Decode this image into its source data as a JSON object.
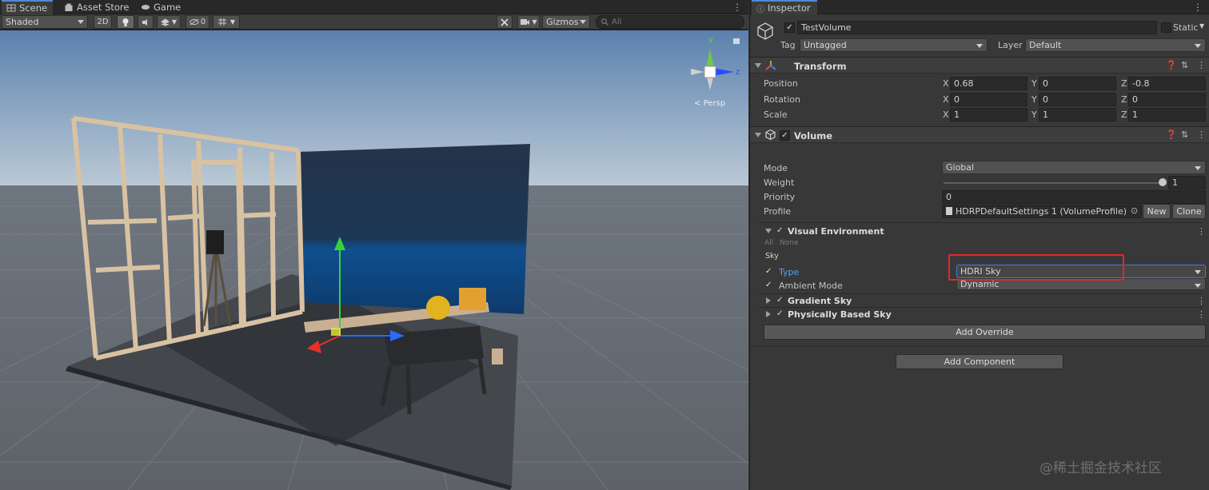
{
  "scene_tabs": [
    {
      "label": "Scene",
      "icon": "scene-grid-icon"
    },
    {
      "label": "Asset Store",
      "icon": "store-bag-icon"
    },
    {
      "label": "Game",
      "icon": "gamepad-icon"
    }
  ],
  "scene_toolbar": {
    "shading_mode": "Shaded",
    "mode_2d": "2D",
    "hidden_count": "0",
    "gizmos": "Gizmos",
    "search_placeholder": "All"
  },
  "viewport": {
    "orientation_axes": {
      "y": "y",
      "z": "z"
    },
    "projection": "Persp"
  },
  "inspector": {
    "tab": "Inspector",
    "object": {
      "name": "TestVolume",
      "static_label": "Static",
      "tag_label": "Tag",
      "tag": "Untagged",
      "layer_label": "Layer",
      "layer": "Default"
    },
    "transform": {
      "title": "Transform",
      "rows": [
        {
          "label": "Position",
          "x": "0.68",
          "y": "0",
          "z": "-0.8"
        },
        {
          "label": "Rotation",
          "x": "0",
          "y": "0",
          "z": "0"
        },
        {
          "label": "Scale",
          "x": "1",
          "y": "1",
          "z": "1"
        }
      ],
      "axis_labels": [
        "X",
        "Y",
        "Z"
      ]
    },
    "volume": {
      "title": "Volume",
      "mode_label": "Mode",
      "mode": "Global",
      "weight_label": "Weight",
      "weight": "1",
      "weight_fraction": 1.0,
      "priority_label": "Priority",
      "priority": "0",
      "profile_label": "Profile",
      "profile": "HDRPDefaultSettings 1 (VolumeProfile)",
      "new_button": "New",
      "clone_button": "Clone"
    },
    "visual_environment": {
      "title": "Visual Environment",
      "all": "All",
      "none": "None",
      "section": "Sky",
      "type_label": "Type",
      "type_value": "HDRI Sky",
      "ambient_label": "Ambient Mode",
      "ambient_value": "Dynamic"
    },
    "overrides": [
      "Gradient Sky",
      "Physically Based Sky"
    ],
    "add_override": "Add Override",
    "add_component": "Add Component"
  },
  "watermark": "@稀土掘金技术社区",
  "colors": {
    "accent_tab": "#4d8bd7",
    "highlight_box": "#e0282c",
    "type_label": "#5aa0f0"
  }
}
